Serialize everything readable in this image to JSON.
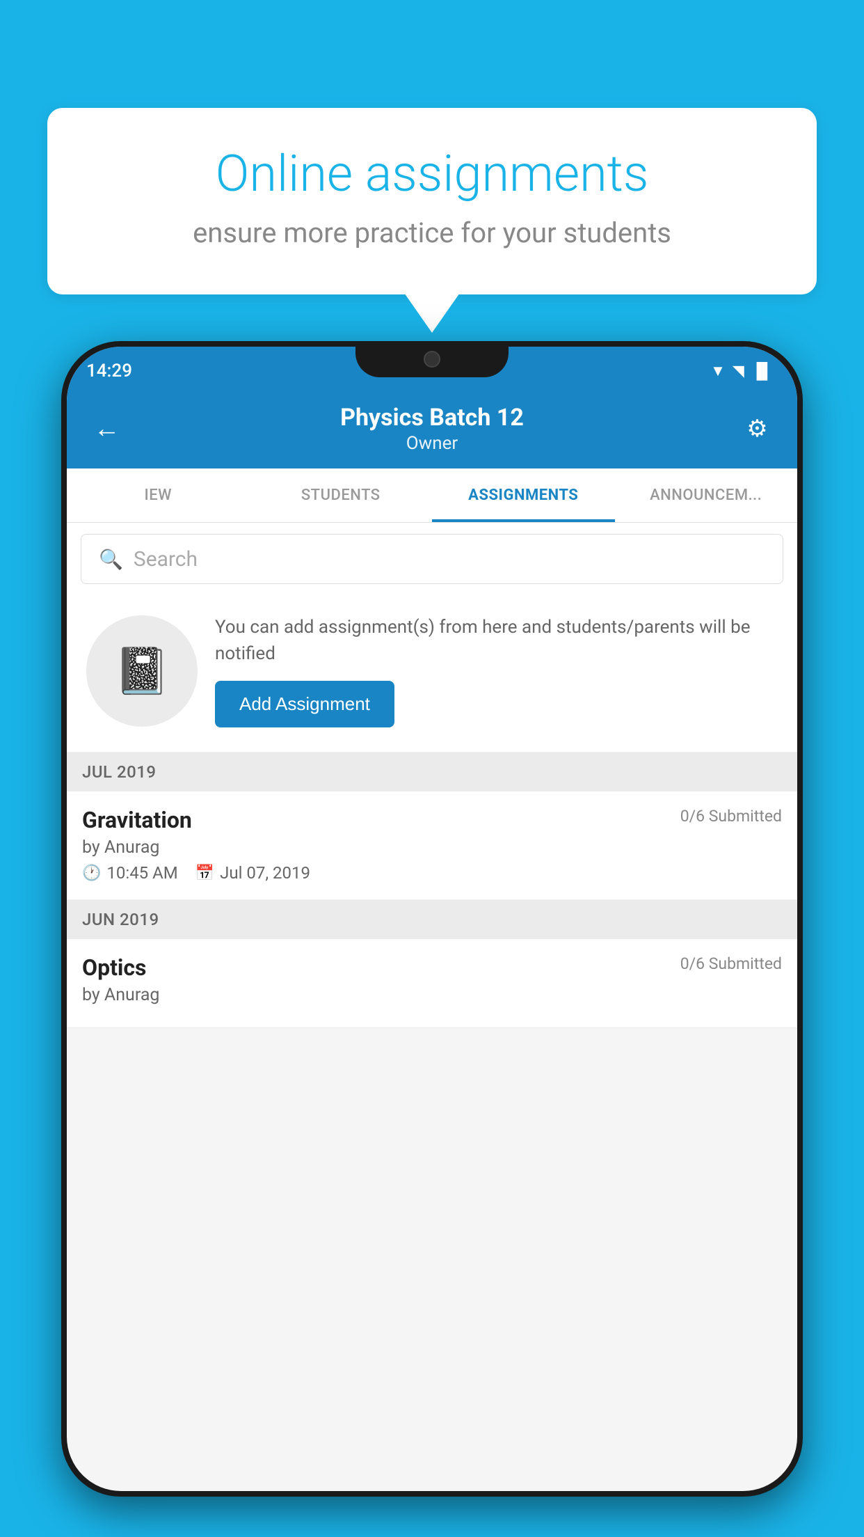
{
  "background_color": "#1ab3e8",
  "speech_bubble": {
    "title": "Online assignments",
    "subtitle": "ensure more practice for your students"
  },
  "status_bar": {
    "time": "14:29",
    "wifi": "▲",
    "signal": "▲",
    "battery": "▐"
  },
  "header": {
    "back_label": "←",
    "title": "Physics Batch 12",
    "subtitle": "Owner",
    "settings_label": "⚙"
  },
  "tabs": [
    {
      "label": "IEW",
      "active": false
    },
    {
      "label": "STUDENTS",
      "active": false
    },
    {
      "label": "ASSIGNMENTS",
      "active": true
    },
    {
      "label": "ANNOUNCEM...",
      "active": false
    }
  ],
  "search": {
    "placeholder": "Search"
  },
  "info_card": {
    "description": "You can add assignment(s) from here and students/parents will be notified",
    "button_label": "Add Assignment"
  },
  "sections": [
    {
      "label": "JUL 2019",
      "assignments": [
        {
          "name": "Gravitation",
          "submitted": "0/6 Submitted",
          "author": "by Anurag",
          "time": "10:45 AM",
          "date": "Jul 07, 2019"
        }
      ]
    },
    {
      "label": "JUN 2019",
      "assignments": [
        {
          "name": "Optics",
          "submitted": "0/6 Submitted",
          "author": "by Anurag",
          "time": "",
          "date": ""
        }
      ]
    }
  ]
}
